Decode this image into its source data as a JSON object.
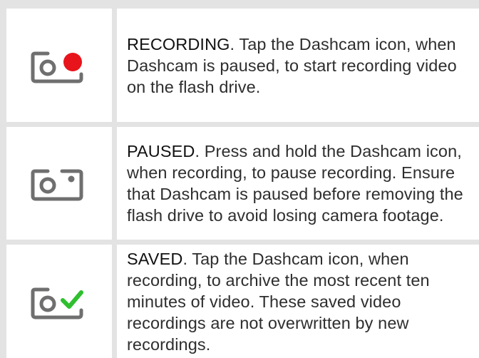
{
  "rows": [
    {
      "status": "RECORDING",
      "text": ". Tap the Dashcam icon, when Dashcam is paused, to start recording video on the flash drive.",
      "icon": "dashcam-recording-icon",
      "indicator_color": "#e8141b"
    },
    {
      "status": "PAUSED",
      "text": ". Press and hold the Dashcam icon, when recording, to pause recording. Ensure that Dashcam is paused before removing the flash drive to avoid losing camera footage.",
      "icon": "dashcam-paused-icon",
      "indicator_color": "#6f6f6f"
    },
    {
      "status": "SAVED",
      "text": ". Tap the Dashcam icon, when recording, to archive the most recent ten minutes of video. These saved video recordings are not overwritten by new recordings.",
      "icon": "dashcam-saved-icon",
      "indicator_color": "#2fbf2f"
    }
  ],
  "colors": {
    "border": "#e3e3e3",
    "icon_gray": "#6f6f6f",
    "text": "#2e2e2e"
  }
}
